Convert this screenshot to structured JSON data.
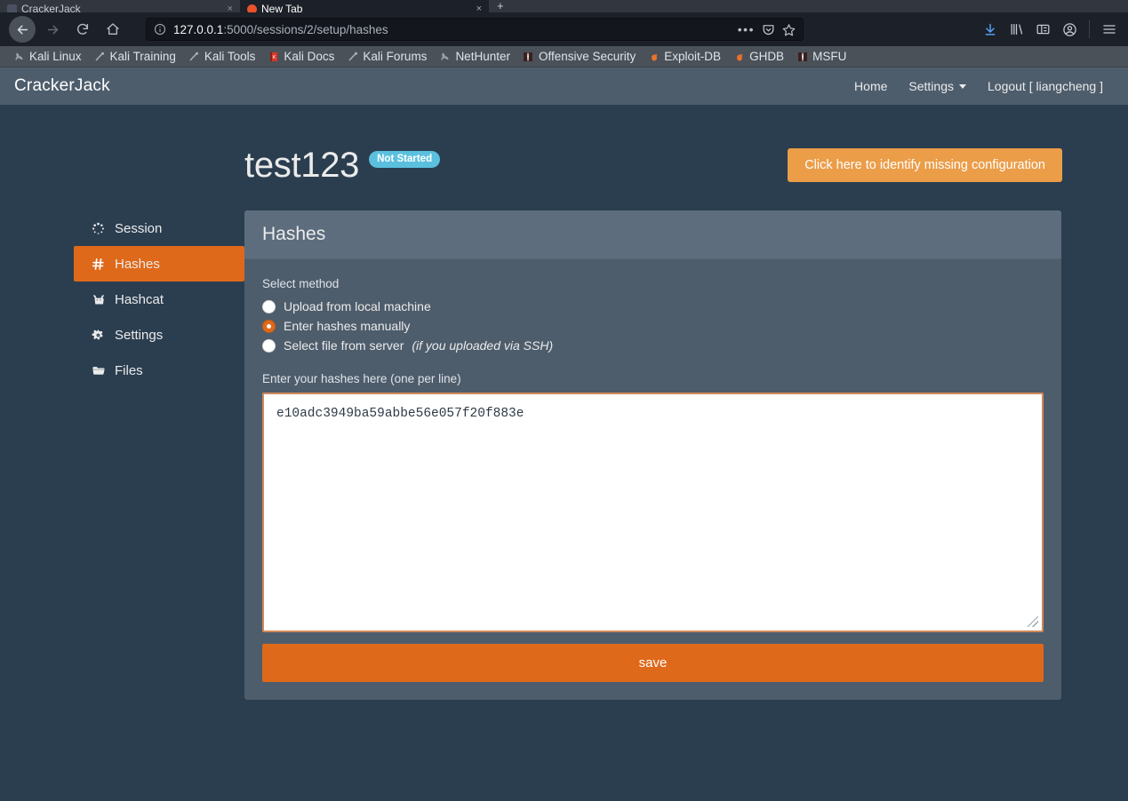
{
  "browser": {
    "tabs": [
      {
        "title": "CrackerJack",
        "active": false
      },
      {
        "title": "New Tab",
        "active": true
      }
    ],
    "new_tab_label": "+",
    "close_glyph": "×",
    "url": {
      "host": "127.0.0.1",
      "path": ":5000/sessions/2/setup/hashes"
    },
    "dots_label": "•••",
    "bookmarks": [
      {
        "label": "Kali Linux",
        "icon": "dragon-icon"
      },
      {
        "label": "Kali Training",
        "icon": "wrench-icon"
      },
      {
        "label": "Kali Tools",
        "icon": "wrench-icon"
      },
      {
        "label": "Kali Docs",
        "icon": "book-icon"
      },
      {
        "label": "Kali Forums",
        "icon": "wrench-icon"
      },
      {
        "label": "NetHunter",
        "icon": "dragon-icon"
      },
      {
        "label": "Offensive Security",
        "icon": "tower-icon"
      },
      {
        "label": "Exploit-DB",
        "icon": "bug-icon"
      },
      {
        "label": "GHDB",
        "icon": "bug-icon"
      },
      {
        "label": "MSFU",
        "icon": "tower-icon"
      }
    ],
    "toolbar_icons": [
      "download-icon",
      "library-icon",
      "sidebar-icon",
      "account-icon",
      "menu-icon"
    ]
  },
  "app": {
    "brand": "CrackerJack",
    "nav": [
      {
        "label": "Home",
        "caret": false
      },
      {
        "label": "Settings",
        "caret": true
      },
      {
        "label": "Logout [ liangcheng ]",
        "caret": false
      }
    ]
  },
  "header": {
    "title": "test123",
    "status_badge": "Not Started",
    "config_button": "Click here to identify missing configuration",
    "badge_color": "#5bc0de",
    "config_button_color": "#eb9d48"
  },
  "sidebar": {
    "items": [
      {
        "label": "Session",
        "icon": "spinner-icon",
        "active": false
      },
      {
        "label": "Hashes",
        "icon": "hashtag-icon",
        "active": true
      },
      {
        "label": "Hashcat",
        "icon": "cat-icon",
        "active": false
      },
      {
        "label": "Settings",
        "icon": "gear-icon",
        "active": false
      },
      {
        "label": "Files",
        "icon": "folder-icon",
        "active": false
      }
    ],
    "active_color": "#df691a"
  },
  "panel": {
    "title": "Hashes",
    "method_label": "Select method",
    "methods": [
      {
        "label": "Upload from local machine",
        "hint": "",
        "checked": false
      },
      {
        "label": "Enter hashes manually",
        "hint": "",
        "checked": true
      },
      {
        "label": "Select file from server",
        "hint": "(if you uploaded via SSH)",
        "checked": false
      }
    ],
    "textarea_label": "Enter your hashes here (one per line)",
    "textarea_value": "e10adc3949ba59abbe56e057f20f883e",
    "textarea_placeholder": "",
    "save_label": "save",
    "save_color": "#df691a"
  }
}
